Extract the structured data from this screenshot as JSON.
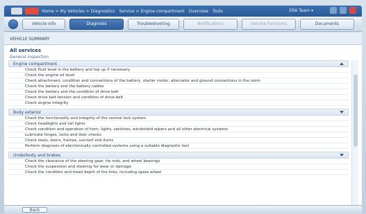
{
  "app": {
    "breadcrumb": [
      "Home > My Vehicles > Diagnostics",
      "Service > Engine compartment",
      "Overview",
      "Tools"
    ],
    "user": "ERA Team ▾"
  },
  "toolbar": {
    "tabs": [
      {
        "label": "Vehicle info",
        "state": "normal"
      },
      {
        "label": "Diagnosis",
        "state": "active"
      },
      {
        "label": "Troubleshooting",
        "state": "normal"
      },
      {
        "label": "Notifications",
        "state": "disabled"
      },
      {
        "label": "Service functions",
        "state": "disabled"
      },
      {
        "label": "Documents",
        "state": "normal"
      }
    ]
  },
  "content": {
    "path_text": "VEHICLE SUMMARY",
    "section_title": "All services",
    "subtitle": "General inspection",
    "groups": [
      {
        "title": "Engine compartment",
        "items": [
          "Check fluid level in the battery and top up if necessary",
          "Check the engine oil level",
          "Check attachment, condition and connections of the battery, starter motor, alternator and ground connections in the room",
          "Check the battery and the battery cables",
          "Check the battery and the condition of drive belt",
          "Check drive belt tension and condition of drive belt",
          "Check engine integrity"
        ]
      },
      {
        "title": "Body exterior",
        "items": [
          "Check the functionality and integrity of the central lock system",
          "Check headlights and tail lights",
          "Check condition and operation of horn, lights, switches, windshield wipers and all other electrical systems",
          "Lubricate hinges, locks and door checks",
          "Check seals, doors, frames, sunroof and ducts",
          "Perform diagnosis of electronically controlled systems using a suitable diagnostic tool"
        ]
      },
      {
        "title": "Underbody and brakes",
        "items": [
          "Check the clearance of the steering gear, tie rods, and wheel bearings",
          "Check the suspension and steering for wear or damage",
          "Check the condition and tread depth of the tires, including spare wheel"
        ]
      }
    ]
  },
  "footer": {
    "back_label": "Back"
  }
}
